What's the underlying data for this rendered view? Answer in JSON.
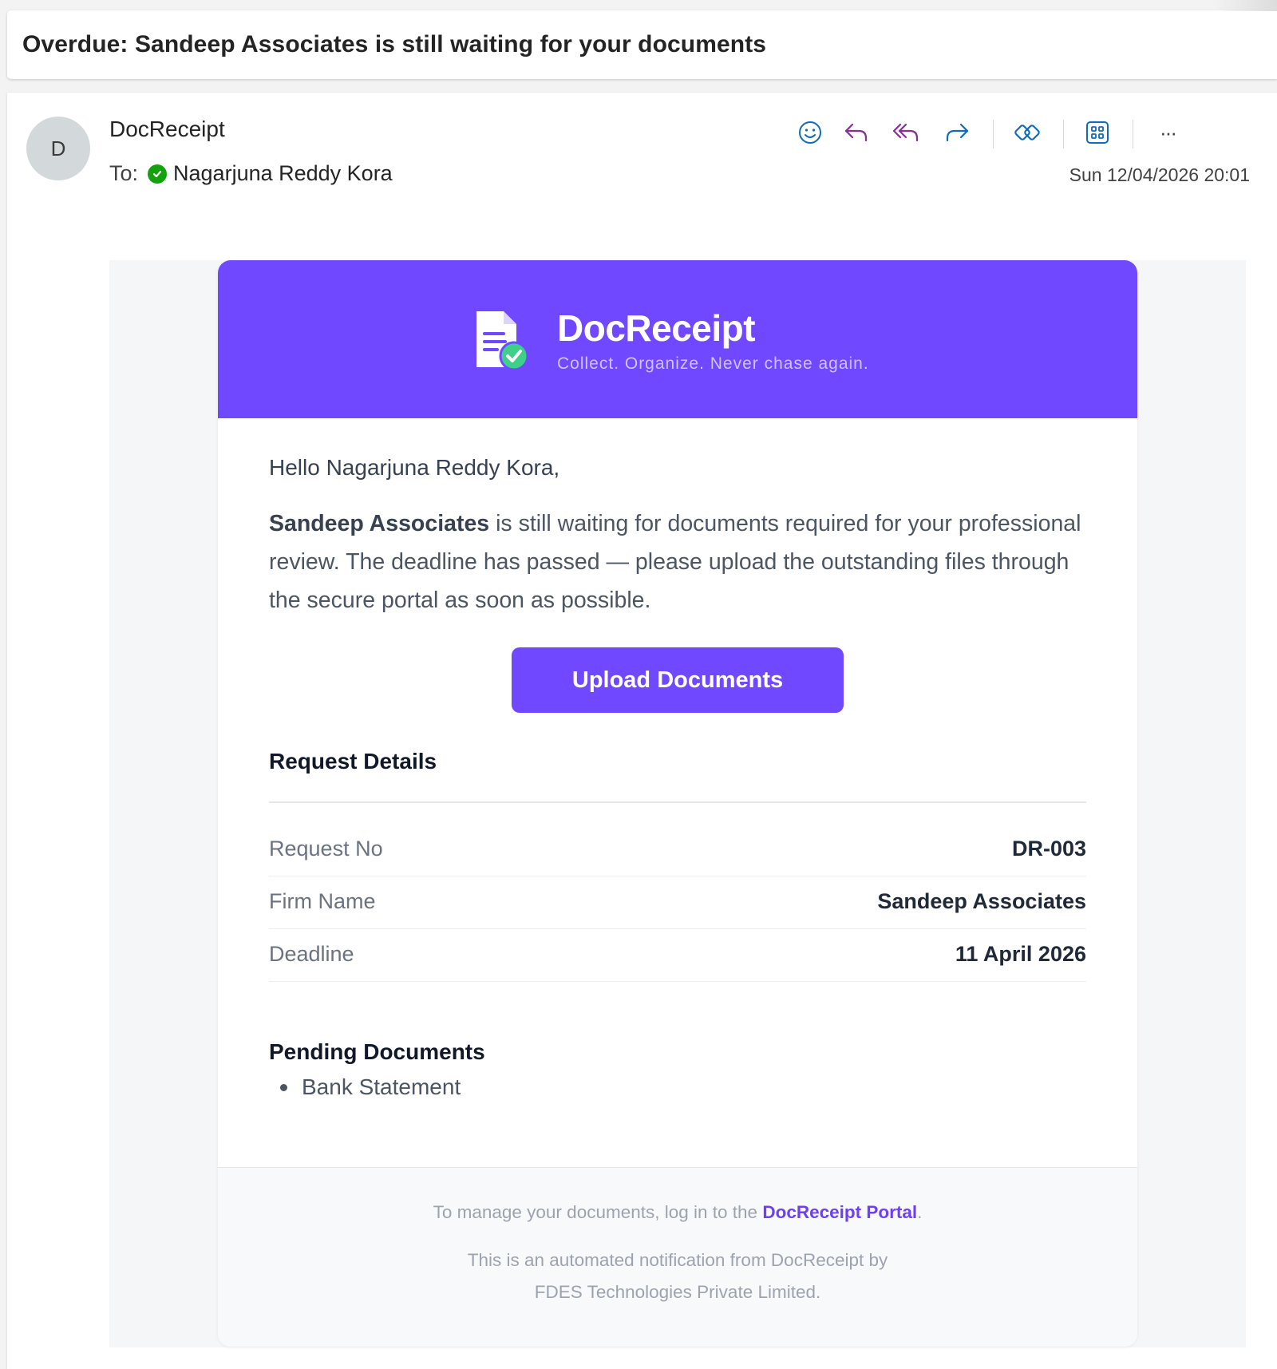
{
  "subject": "Overdue: Sandeep Associates is still waiting for your documents",
  "sender": {
    "avatar_letter": "D",
    "name": "DocReceipt",
    "to_label": "To:",
    "recipient": "Nagarjuna Reddy Kora",
    "datetime": "Sun 12/04/2026 20:01"
  },
  "toolbar": {
    "icons": [
      "emoji-icon",
      "reply-icon",
      "reply-all-icon",
      "forward-icon",
      "loop-icon",
      "apps-icon",
      "more-icon"
    ],
    "more_glyph": "···"
  },
  "email": {
    "brand_name": "DocReceipt",
    "tagline": "Collect. Organize. Never chase again.",
    "greeting": "Hello Nagarjuna Reddy Kora,",
    "message_firm": "Sandeep Associates",
    "message_rest": " is still waiting for documents required for your professional review. The deadline has passed — please upload the outstanding files through the secure portal as soon as possible.",
    "upload_button": "Upload Documents",
    "details_title": "Request Details",
    "details": [
      {
        "label": "Request No",
        "value": "DR-003"
      },
      {
        "label": "Firm Name",
        "value": "Sandeep Associates"
      },
      {
        "label": "Deadline",
        "value": "11 April 2026"
      }
    ],
    "pending_title": "Pending Documents",
    "pending": [
      "Bank Statement"
    ],
    "footer": {
      "line1_prefix": "To manage your documents, log in to the ",
      "portal_link": "DocReceipt Portal",
      "line1_suffix": ".",
      "line2": "This is an automated notification from DocReceipt by",
      "line3": "FDES Technologies Private Limited."
    }
  },
  "colors": {
    "brand": "#7048ff",
    "presence": "#13a10e",
    "toolbar_blue": "#0f6cbd",
    "toolbar_purple": "#8a2b9e"
  }
}
